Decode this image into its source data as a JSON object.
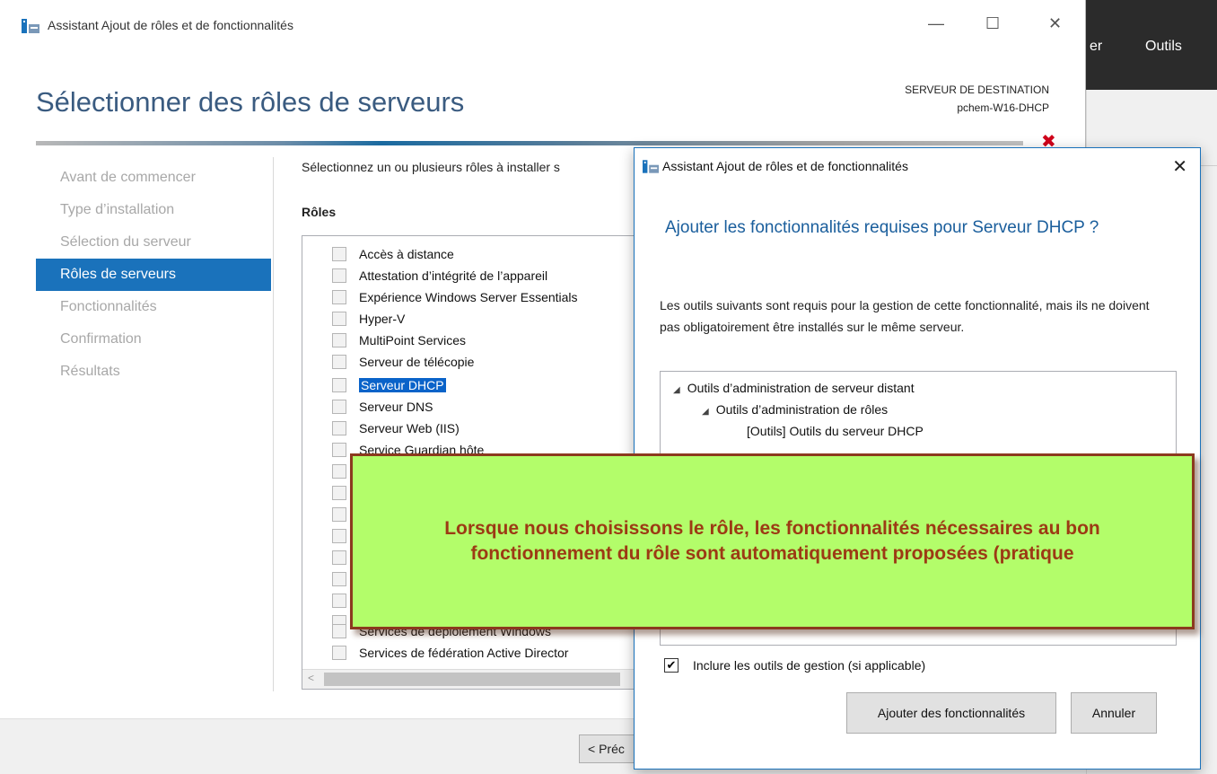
{
  "background_app": {
    "toolbar_items": [
      "er",
      "Outils"
    ]
  },
  "wizard": {
    "title": "Assistant Ajout de rôles et de fonctionnalités",
    "window_controls": {
      "minimize": "—",
      "maximize": "☐",
      "close": "✕"
    },
    "heading": "Sélectionner des rôles de serveurs",
    "destination_label": "SERVEUR DE DESTINATION",
    "destination_server": "pchem-W16-DHCP",
    "error_marker": "✖",
    "nav": [
      "Avant de commencer",
      "Type d’installation",
      "Sélection du serveur",
      "Rôles de serveurs",
      "Fonctionnalités",
      "Confirmation",
      "Résultats"
    ],
    "active_nav_index": 3,
    "instruction": "Sélectionnez un ou plusieurs rôles à installer s",
    "roles_header": "Rôles",
    "roles": [
      "Accès à distance",
      "Attestation d’intégrité de l’appareil",
      "Expérience Windows Server Essentials",
      "Hyper-V",
      "MultiPoint Services",
      "Serveur de télécopie",
      "Serveur DHCP",
      "Serveur DNS",
      "Serveur Web (IIS)",
      "Service Guardian hôte",
      "",
      "",
      "",
      "",
      "",
      "",
      "",
      "",
      "Services de déploiement Windows",
      "Services de fédération Active Director"
    ],
    "selected_role_index": 6,
    "scroll_left_arrow": "<",
    "prev_button": "< Préc"
  },
  "dialog": {
    "title": "Assistant Ajout de rôles et de fonctionnalités",
    "close": "✕",
    "heading": "Ajouter les fonctionnalités requises pour Serveur DHCP ?",
    "description": "Les outils suivants sont requis pour la gestion de cette fonctionnalité, mais ils ne doivent pas obligatoirement être installés sur le même serveur.",
    "tree": [
      {
        "label": "Outils d’administration de serveur distant",
        "expanded": true,
        "level": 0
      },
      {
        "label": "Outils d’administration de rôles",
        "expanded": true,
        "level": 1
      },
      {
        "label": "[Outils] Outils du serveur DHCP",
        "expanded": false,
        "level": 2
      }
    ],
    "include_tools_label": "Inclure les outils de gestion (si applicable)",
    "include_tools_checked": true,
    "check_glyph": "✔",
    "add_button": "Ajouter des fonctionnalités",
    "cancel_button": "Annuler"
  },
  "annotation": {
    "text": "Lorsque nous choisissons le rôle, les fonctionnalités nécessaires au bon fonctionnement du rôle sont automatiquement proposées (pratique"
  },
  "colors": {
    "accent": "#1a72bb",
    "heading_blue": "#3a5b80",
    "callout_bg": "#b3fd6a",
    "callout_text": "#9c3a14",
    "callout_border": "#8b3a1e",
    "error_red": "#d0021b"
  },
  "icons": [
    "server-manager-icon",
    "minimize-icon",
    "maximize-icon",
    "close-icon",
    "error-x-icon",
    "checkbox-icon",
    "expand-triangle-icon",
    "scroll-left-icon"
  ]
}
